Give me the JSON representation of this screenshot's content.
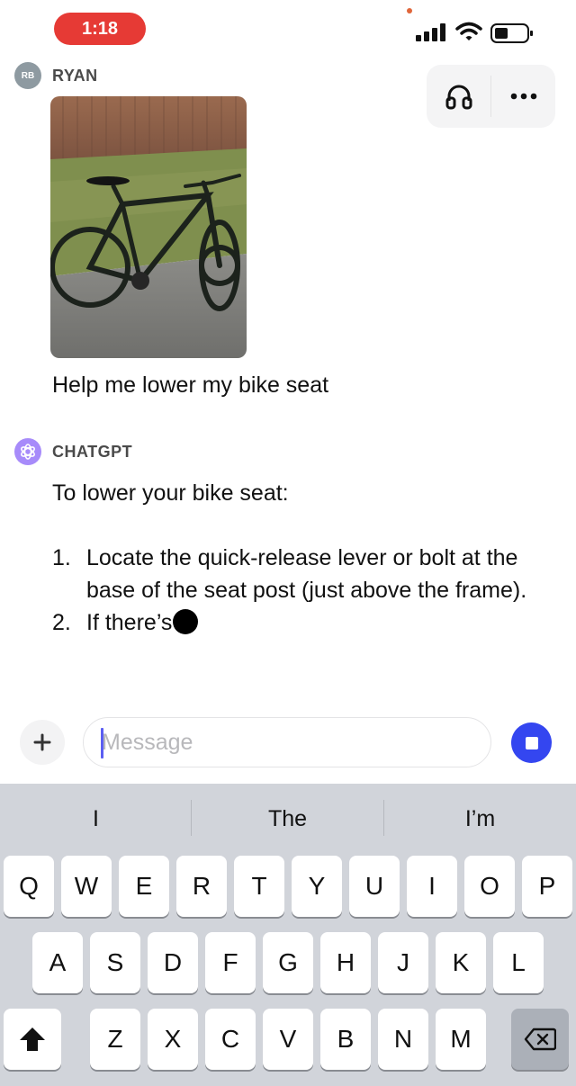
{
  "status_bar": {
    "time": "1:18"
  },
  "header": {
    "voice_icon": "headphones-icon",
    "more_icon": "ellipsis-icon"
  },
  "conversation": {
    "user": {
      "avatar_initials": "RB",
      "name": "RYAN",
      "image_subject": "black hybrid bicycle on driveway",
      "message": "Help me lower my bike seat"
    },
    "assistant": {
      "name": "CHATGPT",
      "intro": "To lower your bike seat:",
      "steps": [
        {
          "num": "1.",
          "text": "Locate the quick-release lever or bolt at the base of the seat post (just above the frame)."
        },
        {
          "num": "2.",
          "text": "If there’s"
        }
      ]
    }
  },
  "composer": {
    "placeholder": "Message",
    "plus_icon": "plus-icon",
    "stop_icon": "stop-icon"
  },
  "keyboard": {
    "suggestions": [
      "I",
      "The",
      "I’m"
    ],
    "row1": [
      "Q",
      "W",
      "E",
      "R",
      "T",
      "Y",
      "U",
      "I",
      "O",
      "P"
    ],
    "row2": [
      "A",
      "S",
      "D",
      "F",
      "G",
      "H",
      "J",
      "K",
      "L"
    ],
    "row3": [
      "Z",
      "X",
      "C",
      "V",
      "B",
      "N",
      "M"
    ],
    "shift_icon": "shift-icon",
    "delete_icon": "backspace-icon"
  },
  "colors": {
    "time_pill": "#e63a35",
    "stop_button": "#3446f0",
    "gpt_avatar": "#a78bfa",
    "keyboard_bg": "#d1d4da"
  }
}
